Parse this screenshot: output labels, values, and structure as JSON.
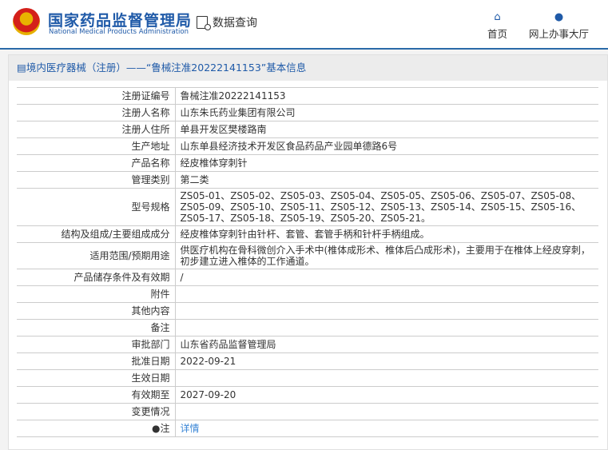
{
  "header": {
    "brand_cn": "国家药品监督管理局",
    "brand_en": "National Medical Products Administration",
    "data_query": "数据查询",
    "nav": [
      {
        "label": "首页",
        "icon": "home-icon"
      },
      {
        "label": "网上办事大厅",
        "icon": "user-icon"
      }
    ]
  },
  "panel": {
    "title": "境内医疗器械（注册）——“鲁械注准20222141153”基本信息"
  },
  "rows": [
    {
      "label": "注册证编号",
      "value": "鲁械注准20222141153"
    },
    {
      "label": "注册人名称",
      "value": "山东朱氏药业集团有限公司"
    },
    {
      "label": "注册人住所",
      "value": "单县开发区樊楼路南"
    },
    {
      "label": "生产地址",
      "value": "山东单县经济技术开发区食品药品产业园单德路6号"
    },
    {
      "label": "产品名称",
      "value": "经皮椎体穿刺针"
    },
    {
      "label": "管理类别",
      "value": "第二类"
    },
    {
      "label": "型号规格",
      "value": "ZS05-01、ZS05-02、ZS05-03、ZS05-04、ZS05-05、ZS05-06、ZS05-07、ZS05-08、ZS05-09、ZS05-10、ZS05-11、ZS05-12、ZS05-13、ZS05-14、ZS05-15、ZS05-16、ZS05-17、ZS05-18、ZS05-19、ZS05-20、ZS05-21。"
    },
    {
      "label": "结构及组成/主要组成成分",
      "value": "经皮椎体穿刺针由针杆、套管、套管手柄和针杆手柄组成。"
    },
    {
      "label": "适用范围/预期用途",
      "value": "供医疗机构在骨科微创介入手术中(椎体成形术、椎体后凸成形术)，主要用于在椎体上经皮穿刺，初步建立进入椎体的工作通道。"
    },
    {
      "label": "产品储存条件及有效期",
      "value": "/"
    },
    {
      "label": "附件",
      "value": ""
    },
    {
      "label": "其他内容",
      "value": ""
    },
    {
      "label": "备注",
      "value": ""
    },
    {
      "label": "审批部门",
      "value": "山东省药品监督管理局"
    },
    {
      "label": "批准日期",
      "value": "2022-09-21"
    },
    {
      "label": "生效日期",
      "value": ""
    },
    {
      "label": "有效期至",
      "value": "2027-09-20"
    },
    {
      "label": "变更情况",
      "value": ""
    }
  ],
  "note": {
    "label": "注",
    "link": "详情"
  }
}
